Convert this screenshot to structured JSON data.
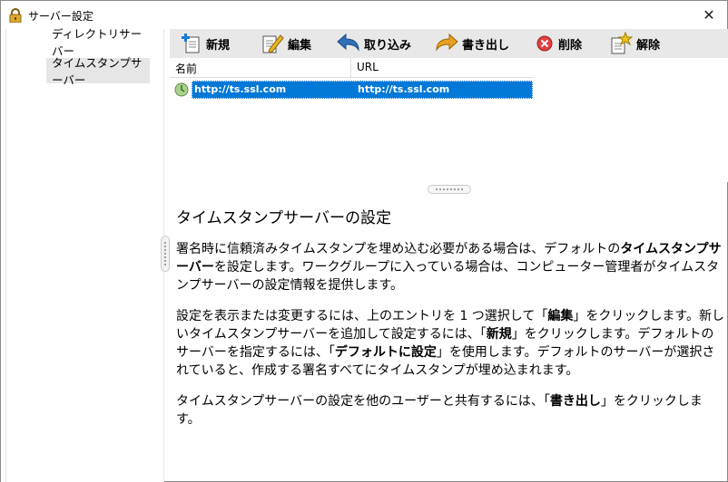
{
  "window": {
    "title": "サーバー設定",
    "close": "✕"
  },
  "sidebar": {
    "items": [
      {
        "label": "ディレクトリサーバー"
      },
      {
        "label": "タイムスタンプサーバー"
      }
    ]
  },
  "toolbar": {
    "new_label": "新規",
    "edit_label": "編集",
    "import_label": "取り込み",
    "export_label": "書き出し",
    "delete_label": "削除",
    "release_label": "解除"
  },
  "list": {
    "columns": {
      "name": "名前",
      "url": "URL"
    },
    "rows": [
      {
        "name": "http://ts.ssl.com",
        "url": "http://ts.ssl.com"
      }
    ]
  },
  "help": {
    "title": "タイムスタンプサーバーの設定",
    "p1_a": "署名時に信頼済みタイムスタンプを埋め込む必要がある場合は、デフォルトの",
    "p1_b": "タイムスタンプサーバー",
    "p1_c": "を設定します。ワークグループに入っている場合は、コンピューター管理者がタイムスタンプサーバーの設定情報を提供します。",
    "p2_a": "設定を表示または変更するには、上のエントリを 1 つ選択して「",
    "p2_b": "編集",
    "p2_c": "」をクリックします。新しいタイムスタンプサーバーを追加して設定するには、「",
    "p2_d": "新規",
    "p2_e": "」をクリックします。デフォルトのサーバーを指定するには、「",
    "p2_f": "デフォルトに設定",
    "p2_g": "」を使用します。デフォルトのサーバーが選択されていると、作成する署名すべてにタイムスタンプが埋め込まれます。",
    "p3_a": "タイムスタンプサーバーの設定を他のユーザーと共有するには、「",
    "p3_b": "書き出し",
    "p3_c": "」をクリックします。"
  }
}
